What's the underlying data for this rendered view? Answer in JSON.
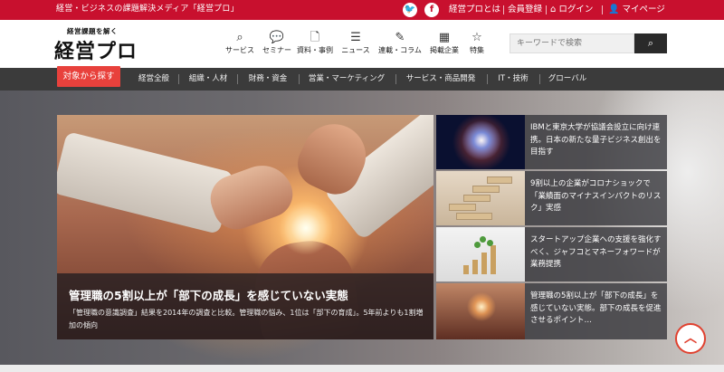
{
  "topbar": {
    "tagline": "経営・ビジネスの課題解決メディア「経営プロ」",
    "social": [
      {
        "icon": "twitter-icon",
        "glyph": "🐦"
      },
      {
        "icon": "facebook-icon",
        "glyph": "f"
      }
    ],
    "links": {
      "about": "経営プロとは",
      "register": "会員登録",
      "login": "ログイン",
      "mypage": "マイページ"
    },
    "icons": {
      "login": "home-icon",
      "mypage": "user-icon"
    }
  },
  "header": {
    "logo_sub": "経営課題を解く",
    "logo_main": "経営プロ",
    "nav": [
      {
        "icon": "search-icon",
        "glyph": "⌕",
        "label": "サービス"
      },
      {
        "icon": "chat-icon",
        "glyph": "💬",
        "label": "セミナー"
      },
      {
        "icon": "document-icon",
        "glyph": "🗋",
        "label": "資料・事例"
      },
      {
        "icon": "news-icon",
        "glyph": "☰",
        "label": "ニュース"
      },
      {
        "icon": "pencil-icon",
        "glyph": "✎",
        "label": "連載・コラム"
      },
      {
        "icon": "building-icon",
        "glyph": "▦",
        "label": "掲載企業"
      },
      {
        "icon": "star-icon",
        "glyph": "☆",
        "label": "特集"
      }
    ],
    "search": {
      "placeholder": "キーワードで検索",
      "button_glyph": "⌕"
    }
  },
  "category_nav": {
    "primary": "対象から探す",
    "items": [
      "経営全般",
      "組織・人材",
      "財務・資金",
      "営業・マーケティング",
      "サービス・商品開発",
      "IT・技術",
      "グローバル"
    ]
  },
  "main_feature": {
    "title": "管理職の5割以上が「部下の成長」を感じていない実態",
    "description": "「管理職の意識調査」結果を2014年の調査と比較。管理職の悩み、1位は「部下の育成」。5年前よりも1割増加の傾向"
  },
  "side_articles": [
    {
      "title": "IBMと東京大学が協議会設立に向け連携。日本の新たな量子ビジネス創出を目指す"
    },
    {
      "title": "9割以上の企業がコロナショックで「業績面のマイナスインパクトのリスク」実感"
    },
    {
      "title": "スタートアップ企業への支援を強化すべく、ジャフコとマネーフォワードが業務提携"
    },
    {
      "title": "管理職の5割以上が「部下の成長」を感じていない実態。部下の成長を促進させるポイント…"
    }
  ],
  "scroll_top": {
    "glyph": "︿"
  }
}
